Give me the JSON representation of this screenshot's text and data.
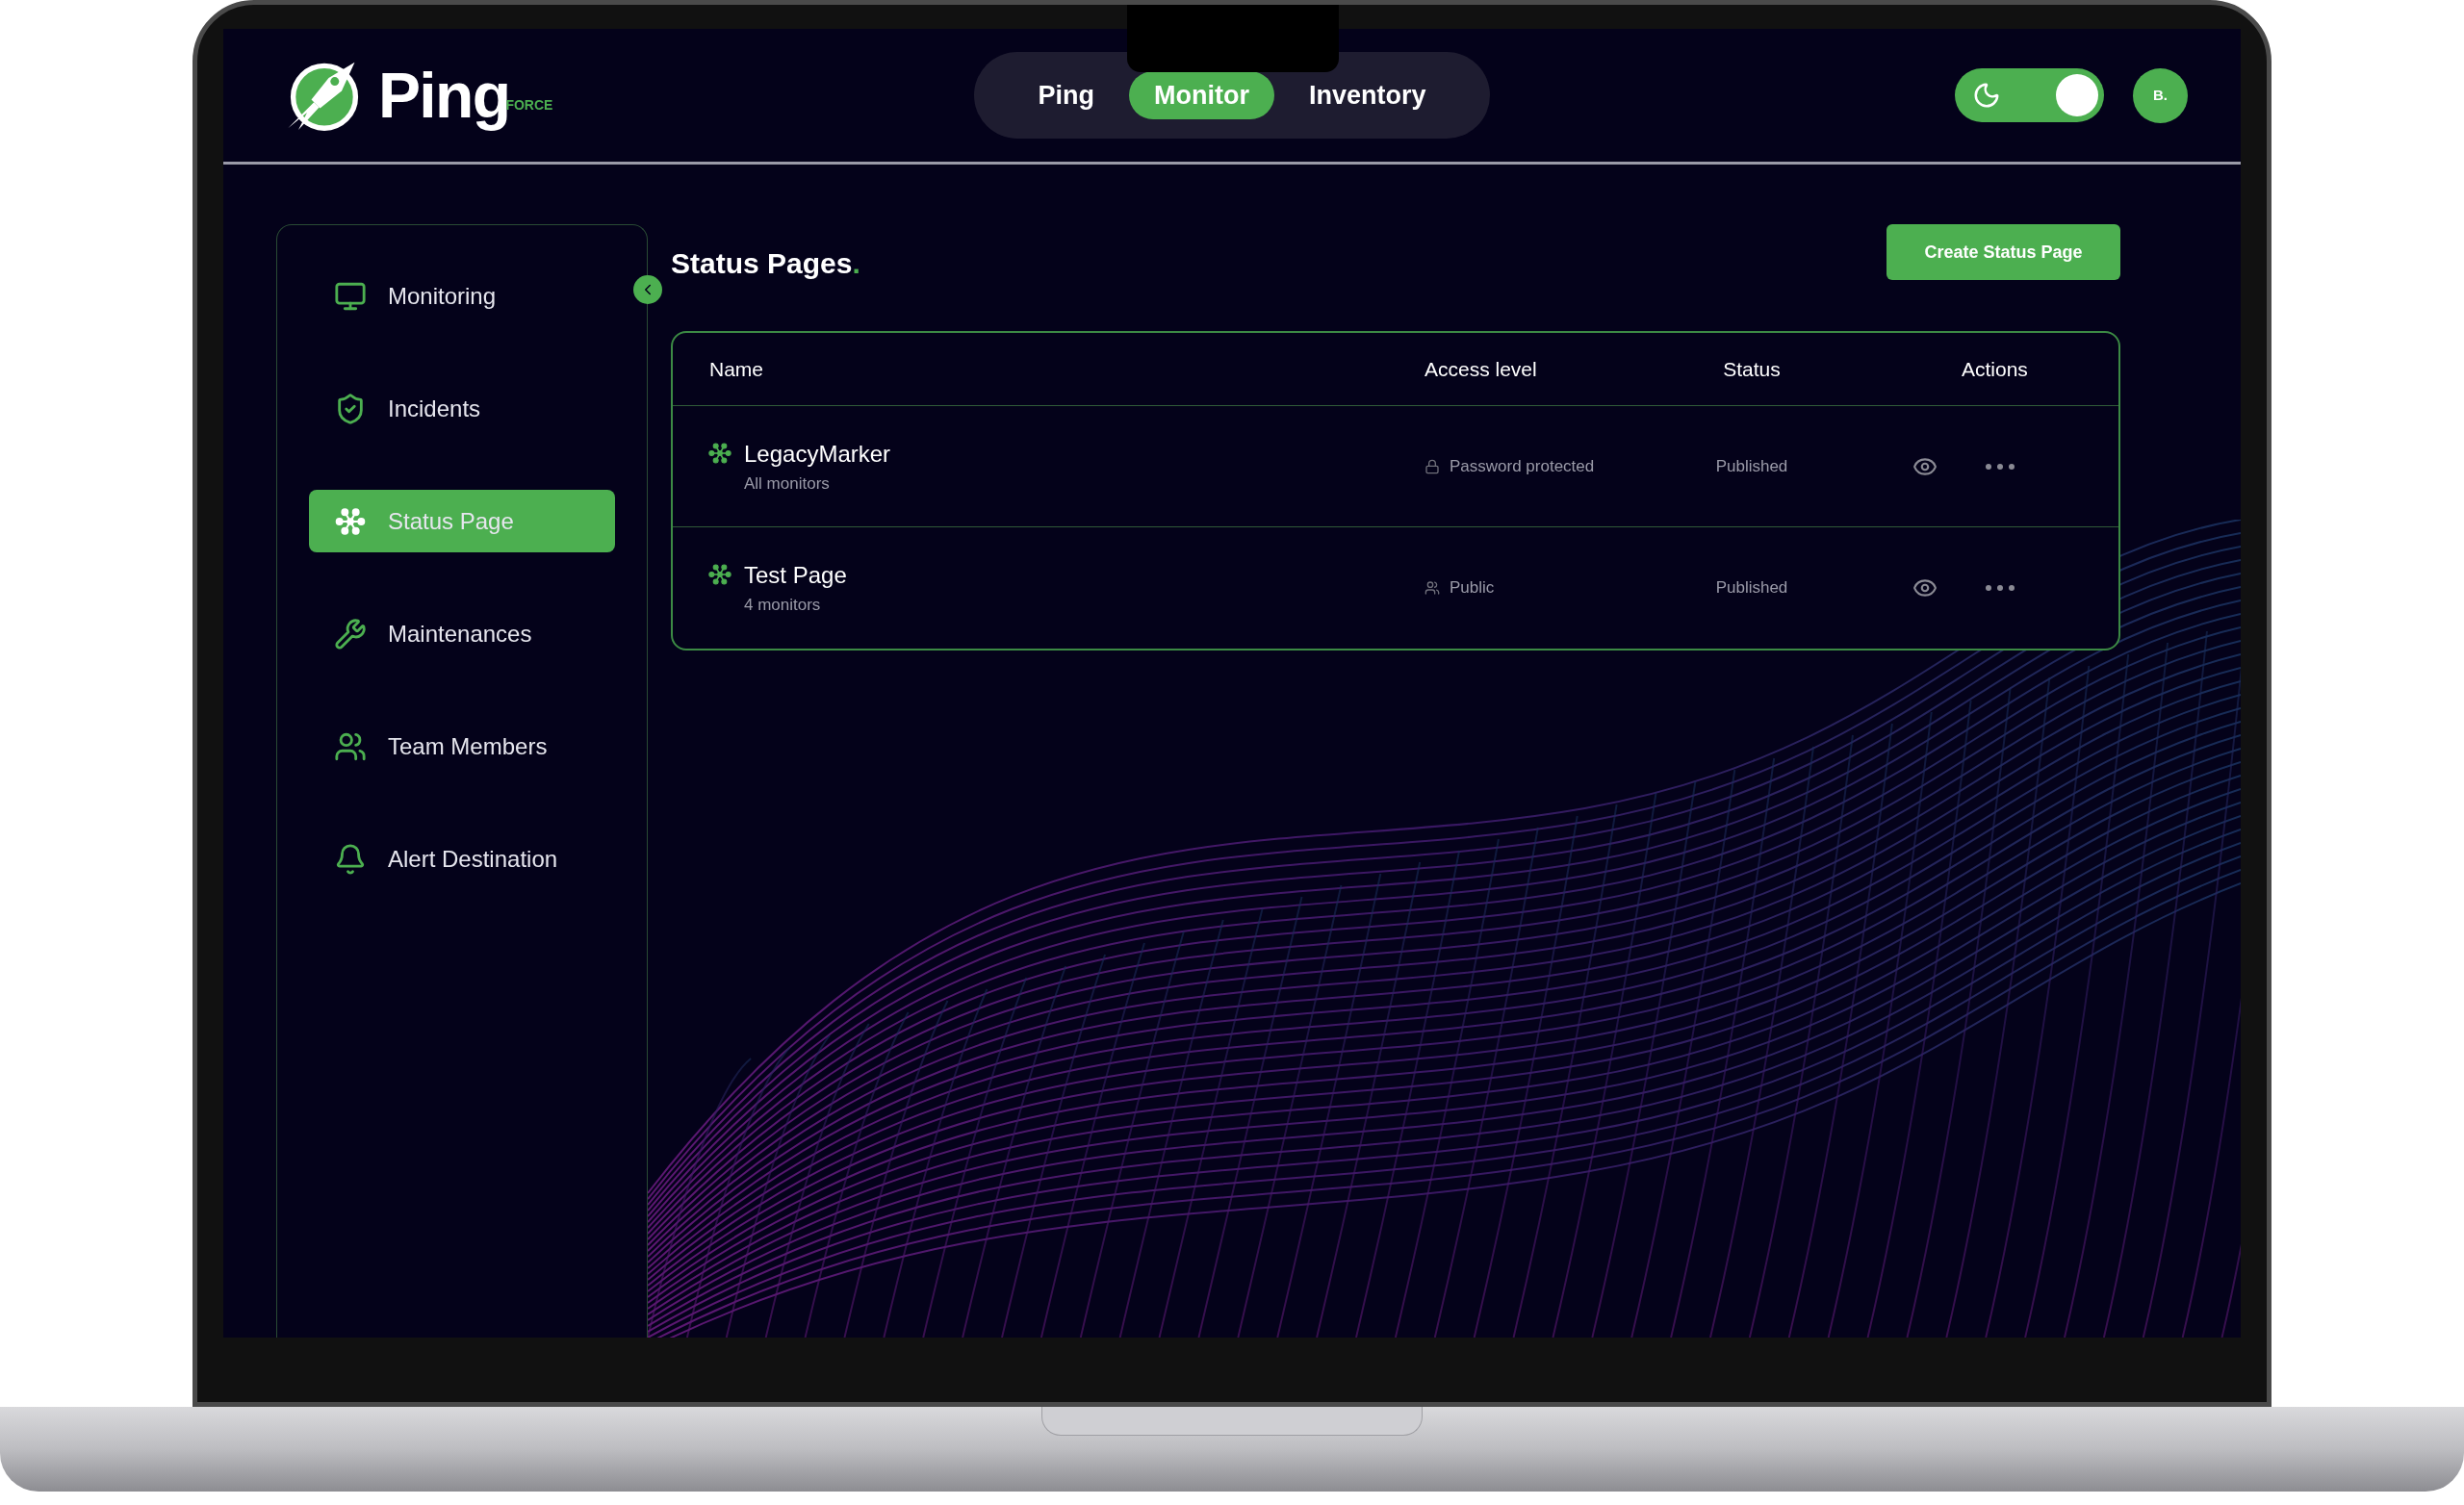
{
  "logo": {
    "name": "Ping",
    "tagline": "FORCE"
  },
  "nav_tabs": [
    {
      "label": "Ping",
      "selected": false
    },
    {
      "label": "Monitor",
      "selected": true
    },
    {
      "label": "Inventory",
      "selected": false
    }
  ],
  "theme_toggle": {
    "on": true
  },
  "avatar": {
    "initials": "B."
  },
  "sidebar": {
    "items": [
      {
        "label": "Monitoring",
        "selected": false
      },
      {
        "label": "Incidents",
        "selected": false
      },
      {
        "label": "Status Page",
        "selected": true
      },
      {
        "label": "Maintenances",
        "selected": false
      },
      {
        "label": "Team Members",
        "selected": false
      },
      {
        "label": "Alert Destination",
        "selected": false
      }
    ]
  },
  "page": {
    "title": "Status Pages",
    "title_suffix": ".",
    "create_button": "Create Status Page"
  },
  "table": {
    "columns": [
      "Name",
      "Access level",
      "Status",
      "Actions"
    ],
    "rows": [
      {
        "name": "LegacyMarker",
        "subtitle": "All monitors",
        "access": "Password protected",
        "kind": "password",
        "status": "Published"
      },
      {
        "name": "Test Page",
        "subtitle": "4 monitors",
        "access": "Public",
        "kind": "public",
        "status": "Published"
      }
    ]
  }
}
